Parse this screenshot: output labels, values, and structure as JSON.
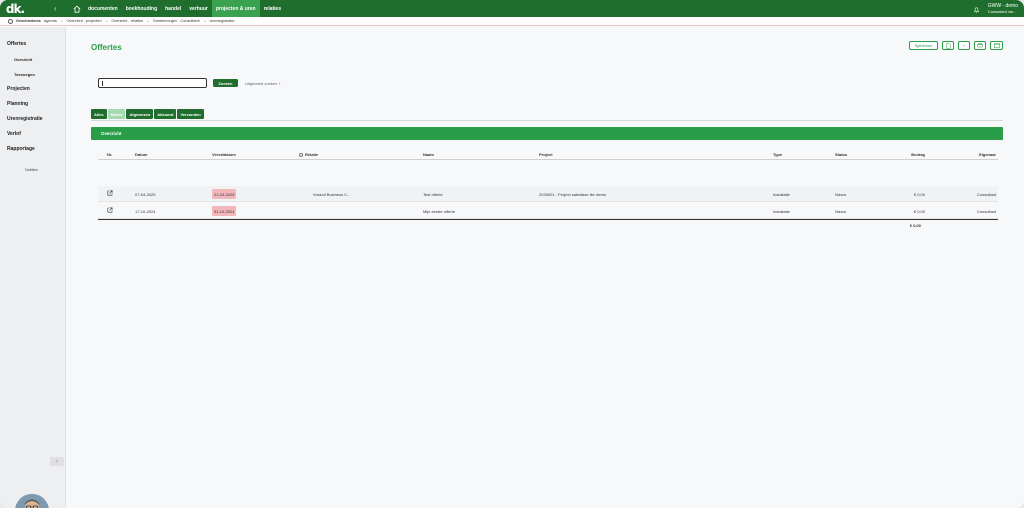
{
  "brand": {
    "logo_text": "dk.",
    "color": "#1f6e2e",
    "accent": "#2a9d48"
  },
  "topnav": {
    "items": [
      {
        "label": "documenten",
        "active": false
      },
      {
        "label": "boekhouding",
        "active": false
      },
      {
        "label": "handel",
        "active": false
      },
      {
        "label": "verhuur",
        "active": false
      },
      {
        "label": "projecten & uren",
        "active": true
      },
      {
        "label": "relaties",
        "active": false
      }
    ],
    "user_name": "GWW - demo",
    "user_role": "Consultant ver..."
  },
  "breadcrumb": {
    "history_label": "Geschiedenis",
    "items": [
      "Agenda",
      "Overzicht - projecten",
      "Overzicht - relaties",
      "Goedemorgen - Consultant!",
      "Urenregistratie"
    ]
  },
  "sidebar": {
    "items": [
      {
        "label": "Offertes"
      },
      {
        "label": "Overzicht"
      },
      {
        "label": "Toevoegen"
      },
      {
        "label": "Projecten"
      },
      {
        "label": "Planning"
      },
      {
        "label": "Urenregistratie"
      },
      {
        "label": "Verlof"
      },
      {
        "label": "Rapportage"
      },
      {
        "label": "Notities"
      }
    ]
  },
  "main": {
    "title": "Offertes",
    "toolbar": {
      "templates_label": "Sjablonen"
    },
    "search": {
      "value": "",
      "button_label": "Zoeken",
      "advanced_label": "Uitgebreid zoeken +"
    },
    "tabs": [
      {
        "label": "Alles",
        "active": false
      },
      {
        "label": "Nieuw",
        "active": true
      },
      {
        "label": "Afgewezen",
        "active": false
      },
      {
        "label": "Akkoord",
        "active": false
      },
      {
        "label": "Verzonden",
        "active": false
      }
    ],
    "panel_title": "Overzicht",
    "table": {
      "columns": [
        "Nr.",
        "Datum",
        "Vervaldatum",
        "Relatie",
        "Naam",
        "Project",
        "Type",
        "Status",
        "Bedrag",
        "Eigenaar"
      ],
      "rows": [
        {
          "datum": "07-04-2025",
          "vervaldatum": "21-04-2025",
          "relatie": "Voskuil Business C...",
          "naam": "Test offerte",
          "project": "2025001 - Project salesfase tbv demo",
          "type": "Installatie",
          "status": "Nieuw",
          "bedrag": "€ 0,00",
          "eigenaar": "Consultant"
        },
        {
          "datum": "17-10-2024",
          "vervaldatum": "31-10-2024",
          "relatie": "",
          "naam": "Mijn eerste offerte",
          "project": "",
          "type": "Installatie",
          "status": "Nieuw",
          "bedrag": "€ 0,00",
          "eigenaar": "Consultant"
        }
      ],
      "total": "€ 0,00",
      "overdue_color": "#f2b7bb"
    }
  }
}
